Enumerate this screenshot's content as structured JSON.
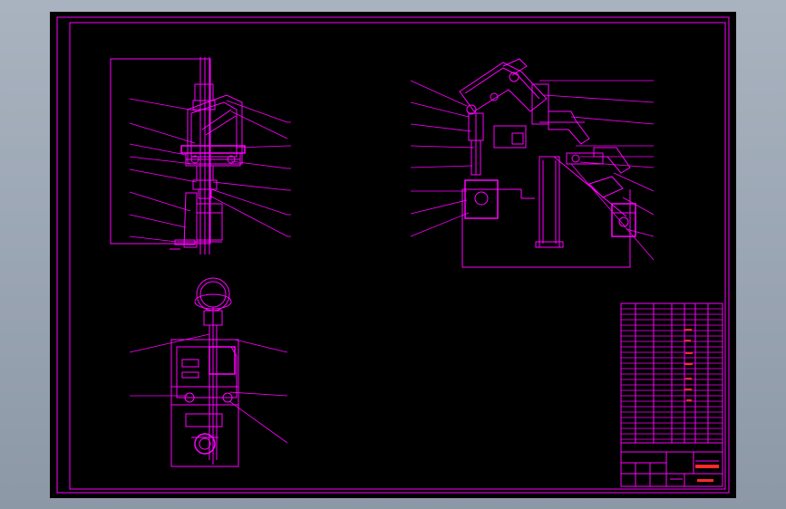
{
  "drawing": {
    "border_color": "#ff00ff",
    "background_color": "#000000",
    "accent_red": "#ff2a2a"
  }
}
